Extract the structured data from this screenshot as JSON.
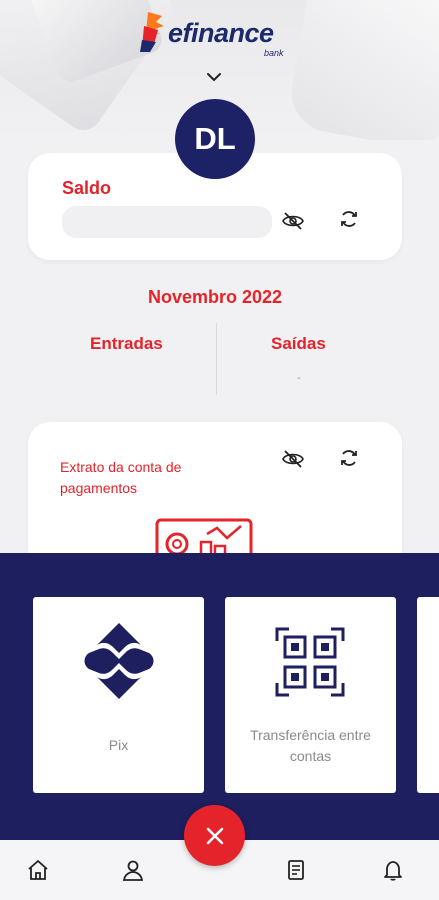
{
  "brand": {
    "name": "efinance",
    "sub": "bank",
    "primary_color": "#1d1f5e",
    "accent_color": "#e5232a"
  },
  "header": {
    "avatar_initials": "DL",
    "chevron": "chevron-down-icon"
  },
  "balance": {
    "title": "Saldo",
    "value": "",
    "hide_icon": "eye-off-icon",
    "refresh_icon": "refresh-icon"
  },
  "summary": {
    "month": "Novembro 2022",
    "income_label": "Entradas",
    "expense_label": "Saídas",
    "expense_value": "-"
  },
  "statement": {
    "title": "Extrato da conta de pagamentos",
    "hide_icon": "eye-off-icon",
    "refresh_icon": "refresh-icon"
  },
  "actions": [
    {
      "label": "Pix",
      "icon": "pix-icon"
    },
    {
      "label": "Transferência entre contas",
      "icon": "qr-code-icon"
    }
  ],
  "fab": {
    "icon": "close-icon"
  },
  "nav": [
    {
      "icon": "home-icon"
    },
    {
      "icon": "user-icon"
    },
    {
      "icon": "receipt-icon"
    },
    {
      "icon": "bell-icon"
    }
  ]
}
